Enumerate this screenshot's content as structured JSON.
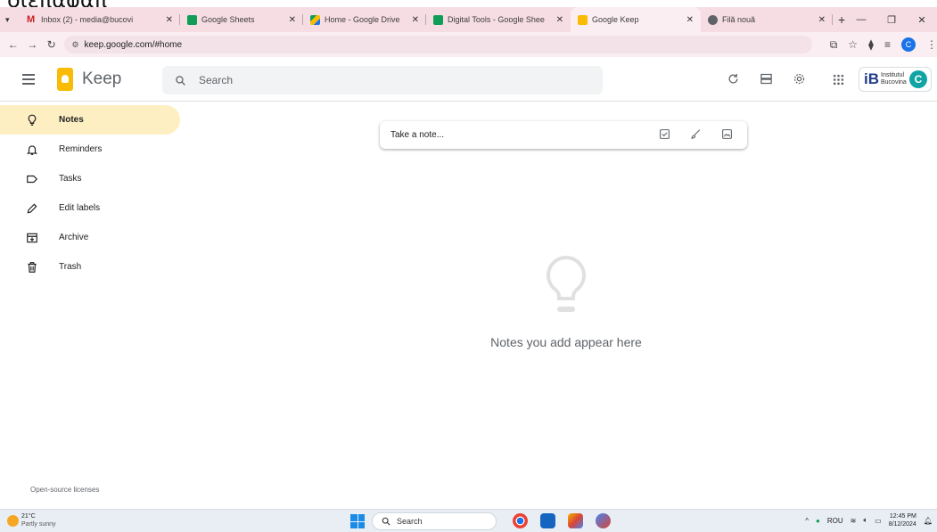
{
  "caption": "διεπαφαπ",
  "browser": {
    "tabs": [
      {
        "title": "Inbox (2) - media@bucovi",
        "color": "#c5221f",
        "active": false
      },
      {
        "title": "Google Sheets",
        "color": "#0f9d58",
        "active": false
      },
      {
        "title": "Home - Google Drive",
        "color": "#1a73e8",
        "active": false
      },
      {
        "title": "Digital Tools - Google Shee",
        "color": "#0f9d58",
        "active": false
      },
      {
        "title": "Google Keep",
        "color": "#f9bb04",
        "active": true
      },
      {
        "title": "Filă nouă",
        "color": "#5f6368",
        "active": false
      }
    ],
    "new_tab": "+",
    "url": "keep.google.com/#home",
    "profile_initial": "C"
  },
  "keep": {
    "title": "Keep",
    "search_placeholder": "Search",
    "org": {
      "mark": "iB",
      "line1": "Institutul",
      "line2": "Bucovina"
    },
    "avatar_initial": "C",
    "sidebar": [
      {
        "label": "Notes",
        "icon": "lightbulb-icon",
        "active": true
      },
      {
        "label": "Reminders",
        "icon": "bell-icon",
        "active": false
      },
      {
        "label": "Tasks",
        "icon": "label-icon",
        "active": false
      },
      {
        "label": "Edit labels",
        "icon": "pencil-icon",
        "active": false
      },
      {
        "label": "Archive",
        "icon": "archive-icon",
        "active": false
      },
      {
        "label": "Trash",
        "icon": "trash-icon",
        "active": false
      }
    ],
    "take_note_placeholder": "Take a note...",
    "empty_text": "Notes you add appear here",
    "footer_link": "Open-source licenses"
  },
  "taskbar": {
    "temperature": "21°C",
    "condition": "Partly sunny",
    "search": "Search",
    "language": "ROU",
    "time": "12:45 PM",
    "date": "8/12/2024"
  }
}
